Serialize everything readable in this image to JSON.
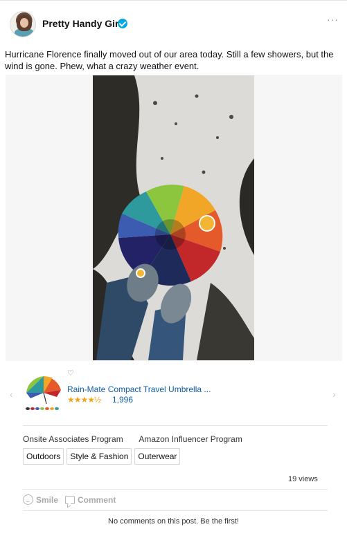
{
  "post": {
    "author": "Pretty Handy Girl",
    "more_label": "···",
    "text": "Hurricane Florence finally moved out of our area today. Still a few showers, but the wind is gone. Phew, what a crazy weather event."
  },
  "product": {
    "title": "Rain-Mate Compact Travel Umbrella ...",
    "stars": "★★★★½",
    "rating_count": "1,996",
    "heart": "♡",
    "prev": "‹",
    "next": "›"
  },
  "programs": [
    "Onsite Associates Program",
    "Amazon Influencer Program"
  ],
  "tags": [
    "Outdoors",
    "Style & Fashion",
    "Outerwear"
  ],
  "stats": {
    "views": "19 views"
  },
  "actions": {
    "smile": "Smile",
    "comment": "Comment"
  },
  "comments": {
    "empty_message": "No comments on this post. Be the first!"
  },
  "colors": {
    "link": "#0f5da6",
    "verified": "#00a8e1",
    "stars": "#f0a51b",
    "hotspot": "#f2b632"
  },
  "icons": [
    "verified-badge-icon",
    "more-options-icon",
    "heart-icon",
    "chevron-left-icon",
    "chevron-right-icon",
    "smile-icon",
    "comment-icon"
  ]
}
